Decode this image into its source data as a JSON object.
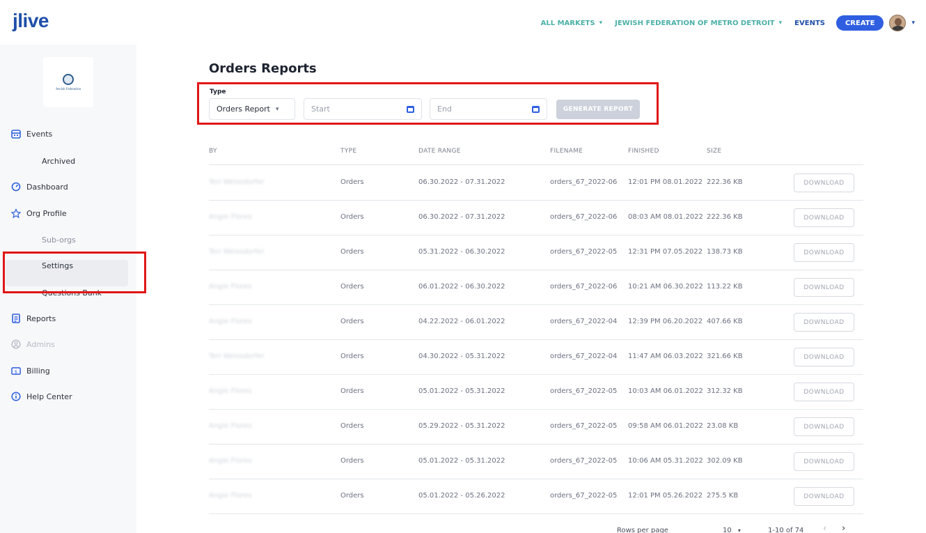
{
  "header": {
    "logo": "jlive",
    "all_markets": "ALL MARKETS",
    "org_name": "JEWISH FEDERATION OF METRO DETROIT",
    "events": "EVENTS",
    "create": "CREATE"
  },
  "sidebar": {
    "org_logo_text": "Jewish Federation",
    "items": {
      "events": "Events",
      "archived": "Archived",
      "dashboard": "Dashboard",
      "org_profile": "Org Profile",
      "sub_orgs": "Sub-orgs",
      "settings": "Settings",
      "questions_bank": "Questions Bank",
      "reports": "Reports",
      "admins": "Admins",
      "billing": "Billing",
      "help_center": "Help Center"
    }
  },
  "main": {
    "title": "Orders Reports",
    "filters": {
      "type_label": "Type",
      "type_value": "Orders Report",
      "start_placeholder": "Start",
      "end_placeholder": "End",
      "generate": "GENERATE REPORT"
    },
    "table": {
      "columns": [
        "BY",
        "TYPE",
        "DATE RANGE",
        "FILENAME",
        "FINISHED",
        "SIZE"
      ],
      "download_label": "DOWNLOAD",
      "rows": [
        {
          "by": "Teri Weissdorfer",
          "type": "Orders",
          "range": "06.30.2022 - 07.31.2022",
          "file": "orders_67_2022-06",
          "finished": "12:01 PM 08.01.2022",
          "size": "222.36 KB"
        },
        {
          "by": "Angie Flores",
          "type": "Orders",
          "range": "06.30.2022 - 07.31.2022",
          "file": "orders_67_2022-06",
          "finished": "08:03 AM 08.01.2022",
          "size": "222.36 KB"
        },
        {
          "by": "Teri Weissdorfer",
          "type": "Orders",
          "range": "05.31.2022 - 06.30.2022",
          "file": "orders_67_2022-05",
          "finished": "12:31 PM 07.05.2022",
          "size": "138.73 KB"
        },
        {
          "by": "Angie Flores",
          "type": "Orders",
          "range": "06.01.2022 - 06.30.2022",
          "file": "orders_67_2022-06",
          "finished": "10:21 AM 06.30.2022",
          "size": "113.22 KB"
        },
        {
          "by": "Angie Flores",
          "type": "Orders",
          "range": "04.22.2022 - 06.01.2022",
          "file": "orders_67_2022-04",
          "finished": "12:39 PM 06.20.2022",
          "size": "407.66 KB"
        },
        {
          "by": "Teri Weissdorfer",
          "type": "Orders",
          "range": "04.30.2022 - 05.31.2022",
          "file": "orders_67_2022-04",
          "finished": "11:47 AM 06.03.2022",
          "size": "321.66 KB"
        },
        {
          "by": "Angie Flores",
          "type": "Orders",
          "range": "05.01.2022 - 05.31.2022",
          "file": "orders_67_2022-05",
          "finished": "10:03 AM 06.01.2022",
          "size": "312.32 KB"
        },
        {
          "by": "Angie Flores",
          "type": "Orders",
          "range": "05.29.2022 - 05.31.2022",
          "file": "orders_67_2022-05",
          "finished": "09:58 AM 06.01.2022",
          "size": "23.08 KB"
        },
        {
          "by": "Angie Flores",
          "type": "Orders",
          "range": "05.01.2022 - 05.31.2022",
          "file": "orders_67_2022-05",
          "finished": "10:06 AM 05.31.2022",
          "size": "302.09 KB"
        },
        {
          "by": "Angie Flores",
          "type": "Orders",
          "range": "05.01.2022 - 05.26.2022",
          "file": "orders_67_2022-05",
          "finished": "12:01 PM 05.26.2022",
          "size": "275.5 KB"
        }
      ]
    },
    "pagination": {
      "rows_per_page_label": "Rows per page",
      "rows_per_page": "10",
      "range": "1-10 of 74",
      "prev": "‹",
      "next": "›"
    }
  },
  "colors": {
    "brand": "#1f4fa8",
    "accent": "#2f5fe0",
    "teal": "#4bb0a6",
    "highlight": "#e01616"
  }
}
